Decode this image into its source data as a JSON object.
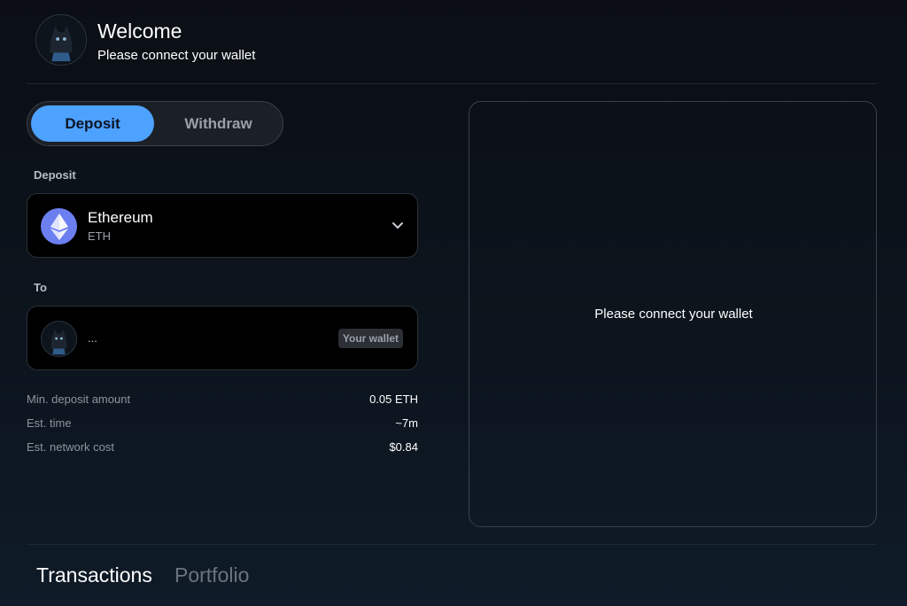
{
  "header": {
    "title": "Welcome",
    "subtitle": "Please connect your wallet"
  },
  "tabs": {
    "deposit": "Deposit",
    "withdraw": "Withdraw",
    "active": "Deposit"
  },
  "deposit_section": {
    "label": "Deposit",
    "token_name": "Ethereum",
    "token_symbol": "ETH"
  },
  "to_section": {
    "label": "To",
    "address": "...",
    "badge": "Your wallet"
  },
  "info": [
    {
      "key": "Min. deposit amount",
      "value": "0.05 ETH"
    },
    {
      "key": "Est. time",
      "value": "~7m"
    },
    {
      "key": "Est. network cost",
      "value": "$0.84"
    }
  ],
  "panel": {
    "message": "Please connect your wallet"
  },
  "bottom_tabs": {
    "transactions": "Transactions",
    "portfolio": "Portfolio",
    "active": "Transactions"
  },
  "colors": {
    "accent": "#4ea2ff",
    "eth": "#6b7ff0",
    "background": "#0c141d"
  },
  "icons": {
    "avatar": "cat-avatar-icon",
    "token": "ethereum-icon",
    "dropdown": "chevron-down-icon"
  }
}
